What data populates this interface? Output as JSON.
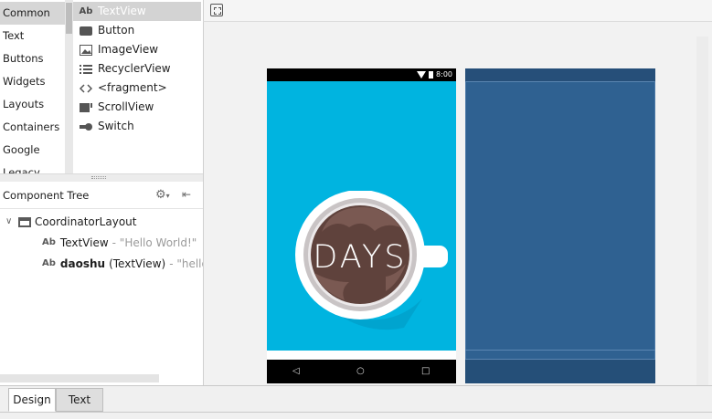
{
  "palette": {
    "categories": [
      {
        "label": "Common",
        "selected": true
      },
      {
        "label": "Text"
      },
      {
        "label": "Buttons"
      },
      {
        "label": "Widgets"
      },
      {
        "label": "Layouts"
      },
      {
        "label": "Containers"
      },
      {
        "label": "Google"
      },
      {
        "label": "Legacy"
      }
    ],
    "items": [
      {
        "label": "TextView",
        "icon": "textview-icon",
        "icon_text": "Ab",
        "selected": true
      },
      {
        "label": "Button",
        "icon": "button-icon"
      },
      {
        "label": "ImageView",
        "icon": "image-icon"
      },
      {
        "label": "RecyclerView",
        "icon": "list-icon"
      },
      {
        "label": "<fragment>",
        "icon": "code-icon",
        "icon_text": "<>"
      },
      {
        "label": "ScrollView",
        "icon": "scrollview-icon"
      },
      {
        "label": "Switch",
        "icon": "switch-icon"
      }
    ]
  },
  "component_tree": {
    "title": "Component Tree",
    "root": {
      "label": "CoordinatorLayout",
      "expand_glyph": "∨"
    },
    "children": [
      {
        "icon_text": "Ab",
        "name": "TextView",
        "detail": "- \"Hello World!\""
      },
      {
        "icon_text": "Ab",
        "name": "daoshu",
        "type": "(TextView)",
        "detail": "- \"hello_"
      }
    ]
  },
  "device": {
    "clock": "8:00",
    "accent": "#00b4e0",
    "logo_text": "DAYS"
  },
  "blueprint": {
    "color": "#2f6191"
  },
  "tabs": [
    {
      "label": "Design",
      "active": true
    },
    {
      "label": "Text"
    }
  ]
}
